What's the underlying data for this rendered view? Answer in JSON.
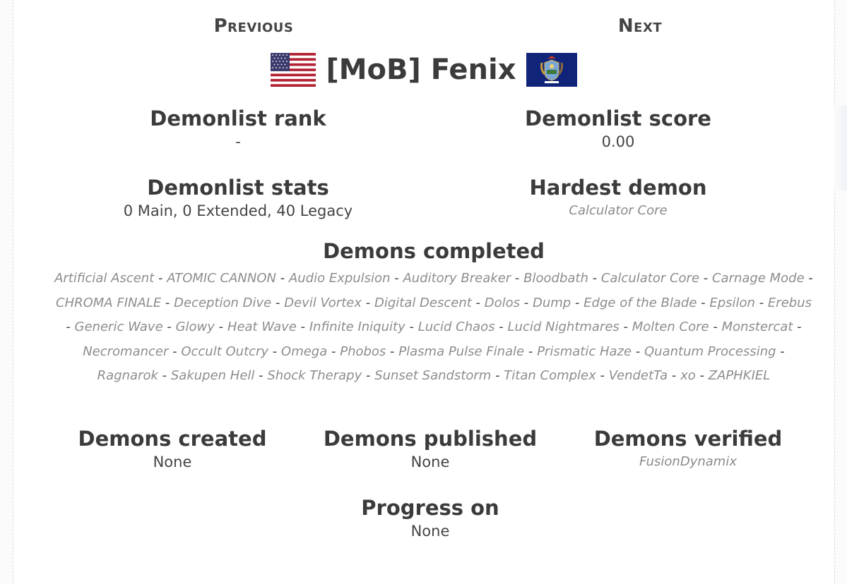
{
  "nav": {
    "previous": "Previous",
    "next": "Next"
  },
  "player": {
    "name": "[MoB] Fenix"
  },
  "stats": {
    "rank_label": "Demonlist rank",
    "rank_value": "-",
    "score_label": "Demonlist score",
    "score_value": "0.00",
    "stats_label": "Demonlist stats",
    "stats_value": "0 Main, 0 Extended, 40 Legacy",
    "hardest_label": "Hardest demon",
    "hardest_value": "Calculator Core"
  },
  "completed": {
    "label": "Demons completed",
    "separator": " - ",
    "items": [
      "Artificial Ascent",
      "ATOMIC CANNON",
      "Audio Expulsion",
      "Auditory Breaker",
      "Bloodbath",
      "Calculator Core",
      "Carnage Mode",
      "CHROMA FINALE",
      "Deception Dive",
      "Devil Vortex",
      "Digital Descent",
      "Dolos",
      "Dump",
      "Edge of the Blade",
      "Epsilon",
      "Erebus",
      "Generic Wave",
      "Glowy",
      "Heat Wave",
      "Infinite Iniquity",
      "Lucid Chaos",
      "Lucid Nightmares",
      "Molten Core",
      "Monstercat",
      "Necromancer",
      "Occult Outcry",
      "Omega",
      "Phobos",
      "Plasma Pulse Finale",
      "Prismatic Haze",
      "Quantum Processing",
      "Ragnarok",
      "Sakupen Hell",
      "Shock Therapy",
      "Sunset Sandstorm",
      "Titan Complex",
      "VendetTa",
      "xo",
      "ZAPHKIEL"
    ]
  },
  "created": {
    "label": "Demons created",
    "value": "None"
  },
  "published": {
    "label": "Demons published",
    "value": "None"
  },
  "verified": {
    "label": "Demons verified",
    "value": "FusionDynamix"
  },
  "progress": {
    "label": "Progress on",
    "value": "None"
  },
  "colors": {
    "accent_text": "#3b3b3b",
    "link_gray": "#8d8d8d",
    "flag_red": "#b22234",
    "flag_blue": "#3c3b6e",
    "mi_blue": "#10257a"
  }
}
